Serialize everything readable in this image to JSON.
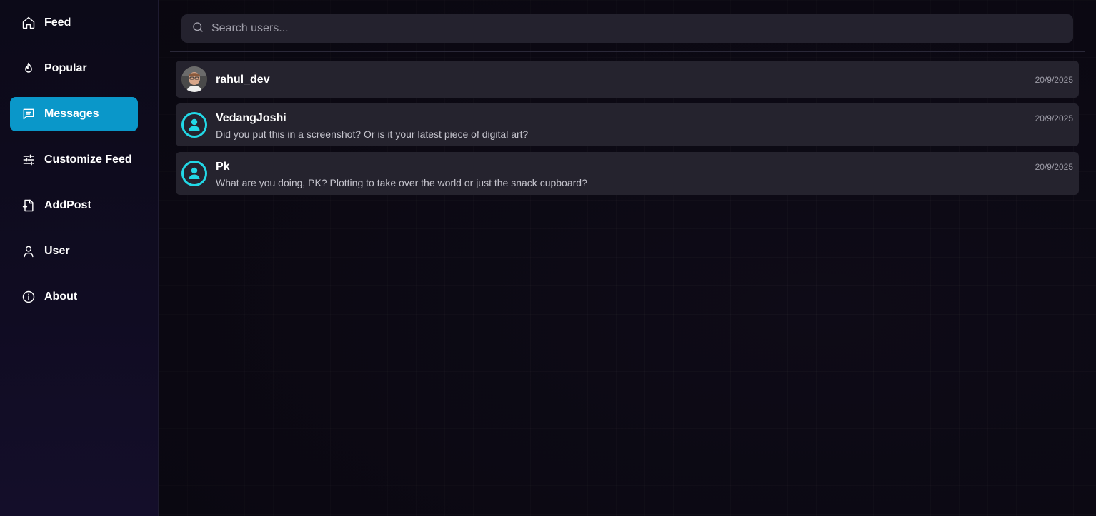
{
  "sidebar": {
    "items": [
      {
        "label": "Feed",
        "icon": "home-icon",
        "active": false
      },
      {
        "label": "Popular",
        "icon": "flame-icon",
        "active": false
      },
      {
        "label": "Messages",
        "icon": "message-icon",
        "active": true
      },
      {
        "label": "Customize Feed",
        "icon": "sliders-icon",
        "active": false
      },
      {
        "label": "AddPost",
        "icon": "file-plus-icon",
        "active": false
      },
      {
        "label": "User",
        "icon": "user-icon",
        "active": false
      },
      {
        "label": "About",
        "icon": "info-icon",
        "active": false
      }
    ]
  },
  "search": {
    "placeholder": "Search users...",
    "value": ""
  },
  "conversations": [
    {
      "name": "rahul_dev",
      "preview": "",
      "time": "20/9/2025",
      "avatar": "photo"
    },
    {
      "name": "VedangJoshi",
      "preview": "Did you put this in a screenshot? Or is it your latest piece of digital art?",
      "time": "20/9/2025",
      "avatar": "default-user-icon"
    },
    {
      "name": "Pk",
      "preview": "What are you doing, PK? Plotting to take over the world or just the snack cupboard?",
      "time": "20/9/2025",
      "avatar": "default-user-icon"
    }
  ],
  "colors": {
    "accent": "#0a97c9",
    "avatar_ring": "#22d8e6",
    "card_bg": "#25232e",
    "background": "#0e0b17"
  }
}
